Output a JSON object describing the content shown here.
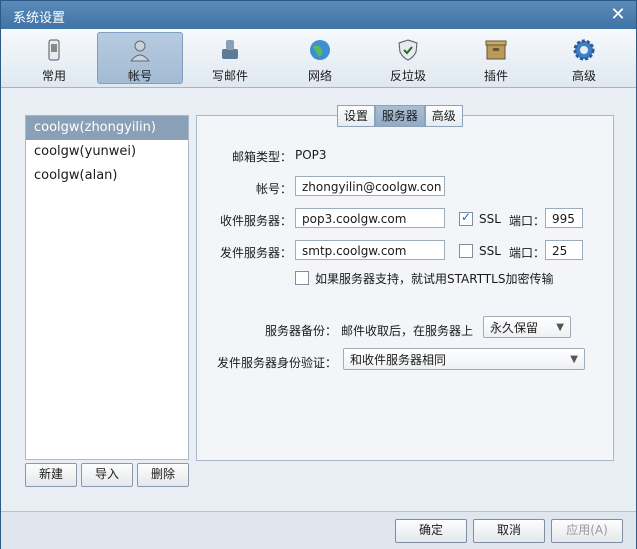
{
  "window": {
    "title": "系统设置"
  },
  "toolbar": {
    "items": [
      {
        "label": "常用",
        "icon": "device-icon"
      },
      {
        "label": "帐号",
        "icon": "user-icon"
      },
      {
        "label": "写邮件",
        "icon": "mail-write-icon"
      },
      {
        "label": "网络",
        "icon": "globe-icon"
      },
      {
        "label": "反垃圾",
        "icon": "shield-icon"
      },
      {
        "label": "插件",
        "icon": "plugin-icon"
      },
      {
        "label": "高级",
        "icon": "gear-icon"
      }
    ],
    "active": "帐号"
  },
  "accounts": {
    "items": [
      "coolgw(zhongyilin)",
      "coolgw(yunwei)",
      "coolgw(alan)"
    ],
    "selected": "coolgw(zhongyilin)",
    "buttons": {
      "new": "新建",
      "import": "导入",
      "delete": "删除"
    }
  },
  "tabs": {
    "items": [
      "设置",
      "服务器",
      "高级"
    ],
    "active": "服务器"
  },
  "server": {
    "mailbox_type_label": "邮箱类型：",
    "mailbox_type": "POP3",
    "account_label": "帐号：",
    "account": "zhongyilin@coolgw.con",
    "incoming_label": "收件服务器：",
    "incoming": "pop3.coolgw.com",
    "incoming_ssl_label": "SSL",
    "incoming_ssl_checked": true,
    "incoming_port_label": "端口：",
    "incoming_port": "995",
    "outgoing_label": "发件服务器：",
    "outgoing": "smtp.coolgw.com",
    "outgoing_ssl_label": "SSL",
    "outgoing_ssl_checked": false,
    "outgoing_port_label": "端口：",
    "outgoing_port": "25",
    "starttls_label": "如果服务器支持，就试用STARTTLS加密传输",
    "backup_label": "服务器备份：",
    "backup_desc": "邮件收取后，在服务器上",
    "backup_value": "永久保留",
    "auth_label": "发件服务器身份验证：",
    "auth_value": "和收件服务器相同"
  },
  "footer": {
    "ok": "确定",
    "cancel": "取消",
    "apply": "应用(A)"
  }
}
